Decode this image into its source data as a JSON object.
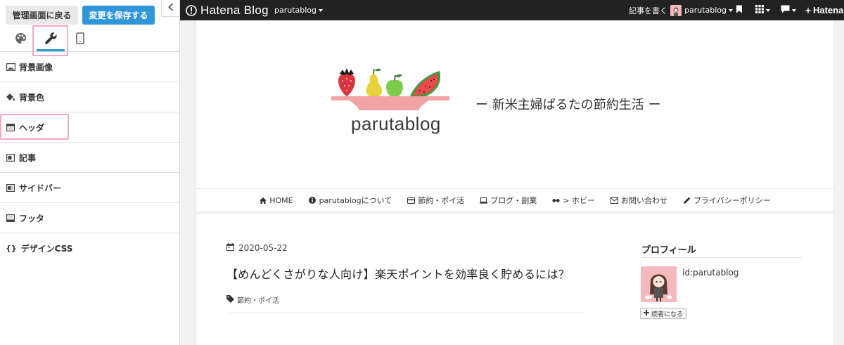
{
  "panel": {
    "back_label": "管理画面に戻る",
    "save_label": "変更を保存する",
    "tabs": [
      {
        "icon": "palette-icon",
        "active": false
      },
      {
        "icon": "wrench-icon",
        "active": true
      },
      {
        "icon": "smartphone-icon",
        "active": false
      }
    ],
    "menu": [
      {
        "icon": "image-icon",
        "label": "背景画像"
      },
      {
        "icon": "paint-bucket-icon",
        "label": "背景色"
      },
      {
        "icon": "header-layout-icon",
        "label": "ヘッダ"
      },
      {
        "icon": "entry-layout-icon",
        "label": "記事"
      },
      {
        "icon": "sidebar-layout-icon",
        "label": "サイドバー"
      },
      {
        "icon": "footer-layout-icon",
        "label": "フッタ"
      },
      {
        "icon": "braces-icon",
        "label": "デザインCSS",
        "prefix": "{}"
      }
    ]
  },
  "topbar": {
    "logo_text": "Hatena Blog",
    "blog_name": "parutablog",
    "write_label": "記事を書く",
    "user_name": "parutablog",
    "hatena_label": "Hatena"
  },
  "blog": {
    "logo_title": "parutablog",
    "tagline": "ー 新米主婦ぱるたの節約生活 ー",
    "nav": [
      {
        "icon": "home-icon",
        "label": "HOME"
      },
      {
        "icon": "info-icon",
        "label": "parutablogについて"
      },
      {
        "icon": "credit-card-icon",
        "label": "節約・ポイ活"
      },
      {
        "icon": "laptop-icon",
        "label": "ブログ・副業"
      },
      {
        "icon": "glasses-icon",
        "label": "> ホビー"
      },
      {
        "icon": "envelope-icon",
        "label": "お問い合わせ"
      },
      {
        "icon": "pencil-icon",
        "label": "プライバシーポリシー"
      }
    ],
    "entry": {
      "date": "2020-05-22",
      "title": "【めんどくさがりな人向け】楽天ポイントを効率良く貯めるには？",
      "category": "節約・ポイ活"
    },
    "sidebar": {
      "profile_title": "プロフィール",
      "profile_id": "id:parutablog",
      "reader_button": "読者になる"
    }
  },
  "colors": {
    "accent": "#2f97d9",
    "highlight": "#f4a7c8",
    "topbar": "#222222"
  }
}
